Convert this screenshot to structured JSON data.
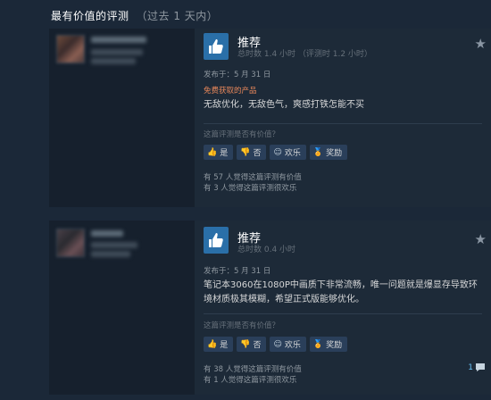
{
  "header": {
    "title": "最有价值的评测",
    "subtitle": "（过去 1 天内）"
  },
  "reviews": [
    {
      "recommendation": "推荐",
      "hours": "总时数 1.4 小时 （评测时 1.2 小时）",
      "posted": "发布于：5 月 31 日",
      "free_label": "免费获取的产品",
      "text": "无敌优化，无敌色气，爽感打铁怎能不买",
      "helpful_question": "这篇评测是否有价值？",
      "buttons": {
        "yes": "是",
        "no": "否",
        "funny": "欢乐",
        "award": "奖励"
      },
      "helpful_count": "有 57 人觉得这篇评测有价值",
      "funny_count": "有 3 人觉得这篇评测很欢乐"
    },
    {
      "recommendation": "推荐",
      "hours": "总时数 0.4 小时",
      "posted": "发布于：5 月 31 日",
      "text": "笔记本3060在1080P中画质下非常流畅，唯一问题就是爆显存导致环境材质极其模糊，希望正式版能够优化。",
      "helpful_question": "这篇评测是否有价值？",
      "buttons": {
        "yes": "是",
        "no": "否",
        "funny": "欢乐",
        "award": "奖励"
      },
      "helpful_count": "有 38 人觉得这篇评测有价值",
      "funny_count": "有 1 人觉得这篇评测很欢乐",
      "comment_count": "1"
    }
  ],
  "colors": {
    "background": "#1b2838",
    "accent_blue": "#67c1f5",
    "free_label": "#e8875a"
  },
  "icons": [
    "thumbs-up-icon",
    "thumbs-down-icon",
    "smile-icon",
    "award-icon",
    "star-icon",
    "comment-icon"
  ]
}
